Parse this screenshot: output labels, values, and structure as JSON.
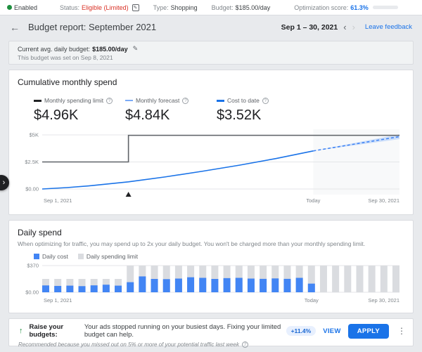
{
  "colors": {
    "accent_blue": "#1a73e8",
    "chart_blue": "#4285f4",
    "bar_gray": "#dadce0",
    "limit_line_gray": "#5f6368",
    "forecast_band_blue": "#aecbfa",
    "status_red": "#d93025",
    "enabled_green": "#1e8e3e",
    "badge_bg": "#e8f0fe",
    "badge_text": "#1967d2"
  },
  "icons": {
    "status_edit": "✎",
    "back_arrow": "←",
    "prev_chevron": "‹",
    "next_chevron": "›",
    "edit_pencil": "✎",
    "info": "?",
    "raise_arrow": "↑",
    "overflow_menu": "⋮",
    "drawer_chevron": "›"
  },
  "topbar": {
    "enabled_label": "Enabled",
    "status_label": "Status:",
    "status_value": "Eligible (Limited)",
    "type_label": "Type:",
    "type_value": "Shopping",
    "budget_label": "Budget:",
    "budget_value": "$185.00/day",
    "opt_label": "Optimization score:",
    "opt_value": "61.3%",
    "opt_fill_pct": 74
  },
  "header": {
    "title": "Budget report: September 2021",
    "date_range": "Sep 1 – 30, 2021",
    "leave_feedback": "Leave feedback"
  },
  "budget_info": {
    "line1_label": "Current avg. daily budget:",
    "line1_value": "$185.00/day",
    "line2": "This budget was set on Sep 8, 2021"
  },
  "cumulative": {
    "title": "Cumulative monthly spend",
    "metrics": [
      {
        "label": "Monthly spending limit",
        "value": "$4.96K"
      },
      {
        "label": "Monthly forecast",
        "value": "$4.84K"
      },
      {
        "label": "Cost to date",
        "value": "$3.52K"
      }
    ]
  },
  "daily": {
    "title": "Daily spend",
    "subtext": "When optimizing for traffic, you may spend up to 2x your daily budget. You won't be charged more than your monthly spending limit.",
    "legend": [
      {
        "label": "Daily cost"
      },
      {
        "label": "Daily spending limit"
      }
    ]
  },
  "recommendation": {
    "title": "Raise your budgets:",
    "body": "Your ads stopped running on your busiest days. Fixing your limited budget can help.",
    "badge": "+11.4%",
    "view_label": "VIEW",
    "apply_label": "APPLY",
    "footnote": "Recommended because you missed out on 5% or more of your potential traffic last week"
  },
  "chart_data": [
    {
      "type": "line",
      "title": "Cumulative monthly spend",
      "x_axis": {
        "days": 30,
        "today_day": 23,
        "labels": {
          "start": "Sep 1, 2021",
          "today": "Today",
          "end": "Sep 30, 2021"
        }
      },
      "y_axis": {
        "range": [
          0,
          5000
        ],
        "ticks": [
          {
            "v": 0,
            "label": "$0.00"
          },
          {
            "v": 2500,
            "label": "$2.5K"
          },
          {
            "v": 5000,
            "label": "$5K"
          }
        ]
      },
      "budget_change_day": 8,
      "series": [
        {
          "name": "Monthly spending limit",
          "style": "step",
          "color": "#5f6368",
          "points": [
            [
              1,
              2500
            ],
            [
              8,
              2500
            ],
            [
              8,
              4960
            ],
            [
              30,
              4960
            ]
          ]
        },
        {
          "name": "Cost to date",
          "style": "solid",
          "color": "#1a73e8",
          "points": [
            [
              1,
              0
            ],
            [
              3,
              130
            ],
            [
              5,
              310
            ],
            [
              8,
              660
            ],
            [
              11,
              1120
            ],
            [
              14,
              1640
            ],
            [
              17,
              2200
            ],
            [
              20,
              2820
            ],
            [
              23,
              3520
            ]
          ]
        },
        {
          "name": "Monthly forecast",
          "style": "dashed",
          "color": "#4285f4",
          "points": [
            [
              23,
              3520
            ],
            [
              30,
              4840
            ]
          ]
        },
        {
          "name": "Forecast range",
          "style": "band",
          "color": "#aecbfa",
          "upper": [
            [
              23,
              3520
            ],
            [
              30,
              5060
            ]
          ],
          "lower": [
            [
              23,
              3520
            ],
            [
              30,
              4610
            ]
          ]
        }
      ],
      "legend_position": "top",
      "grid": true
    },
    {
      "type": "bar",
      "title": "Daily spend",
      "categories": [
        1,
        2,
        3,
        4,
        5,
        6,
        7,
        8,
        9,
        10,
        11,
        12,
        13,
        14,
        15,
        16,
        17,
        18,
        19,
        20,
        21,
        22,
        23,
        24,
        25,
        26,
        27,
        28,
        29,
        30
      ],
      "x_axis": {
        "days": 30,
        "today_day": 23,
        "labels": {
          "start": "Sep 1, 2021",
          "today": "Today",
          "end": "Sep 30, 2021"
        }
      },
      "y_axis": {
        "range": [
          0,
          370
        ],
        "ticks": [
          {
            "v": 0,
            "label": "$0.00"
          },
          {
            "v": 370,
            "label": "$370"
          }
        ]
      },
      "series": [
        {
          "name": "Daily cost",
          "color": "#4285f4",
          "values": [
            95,
            88,
            92,
            85,
            96,
            105,
            92,
            140,
            220,
            185,
            182,
            190,
            208,
            200,
            185,
            196,
            200,
            190,
            186,
            192,
            186,
            200,
            120,
            null,
            null,
            null,
            null,
            null,
            null,
            null
          ]
        },
        {
          "name": "Daily spending limit",
          "color": "#dadce0",
          "values": [
            185,
            185,
            185,
            185,
            185,
            185,
            185,
            370,
            370,
            370,
            370,
            370,
            370,
            370,
            370,
            370,
            370,
            370,
            370,
            370,
            370,
            370,
            370,
            370,
            370,
            370,
            370,
            370,
            370,
            370
          ]
        }
      ],
      "legend_position": "top",
      "grid": true
    }
  ]
}
